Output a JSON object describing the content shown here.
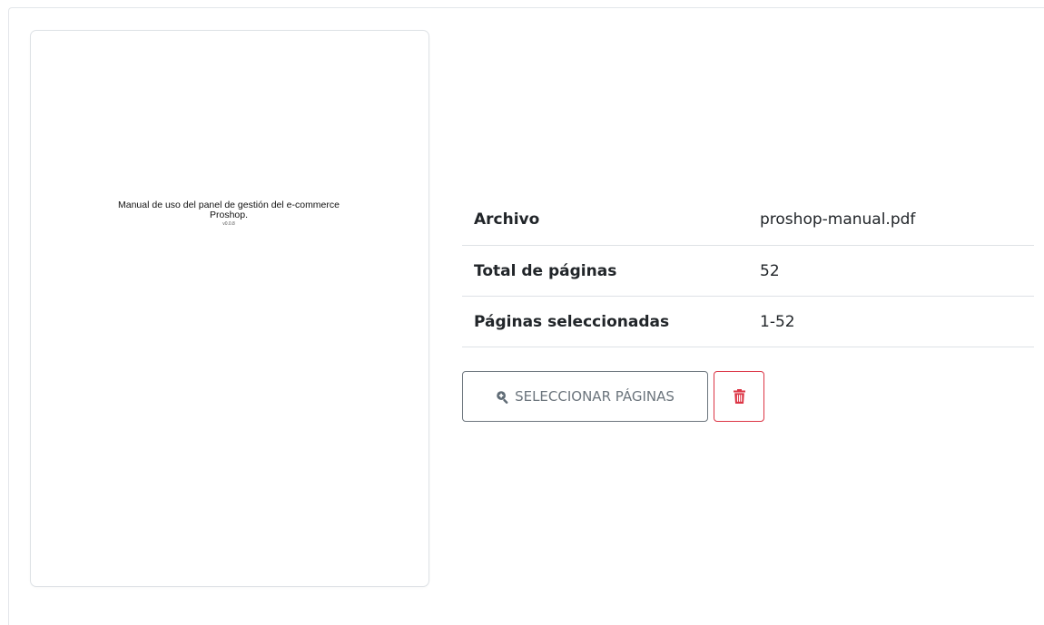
{
  "preview": {
    "title_line1": "Manual de uso del panel de gestión del e-commerce",
    "title_line2": "Proshop.",
    "version": "v0.0.8"
  },
  "file_info": {
    "rows": [
      {
        "label": "Archivo",
        "value": "proshop-manual.pdf"
      },
      {
        "label": "Total de páginas",
        "value": "52"
      },
      {
        "label": "Páginas seleccionadas",
        "value": "1-52"
      }
    ]
  },
  "actions": {
    "select_pages_label": "SELECCIONAR PÁGINAS",
    "select_pages_icon": "zoom-in-icon",
    "delete_icon": "trash-icon"
  },
  "colors": {
    "secondary": "#6c757d",
    "danger": "#dc3545",
    "border": "#dee2e6"
  }
}
